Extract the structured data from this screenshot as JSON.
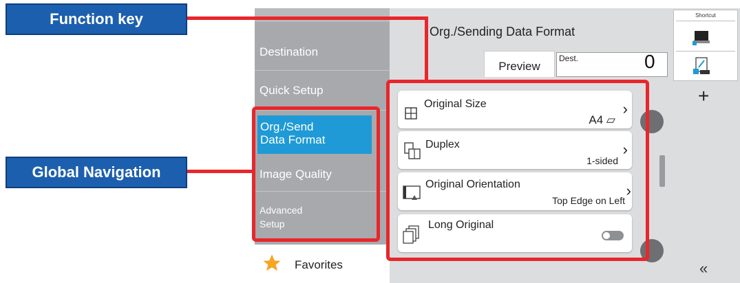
{
  "callouts": {
    "function_key": "Function key",
    "global_navigation": "Global Navigation"
  },
  "nav": {
    "items": [
      {
        "label": "Destination"
      },
      {
        "label": "Quick Setup"
      },
      {
        "label": "Org./Send\nData Format",
        "selected": true
      },
      {
        "label": "Image Quality"
      },
      {
        "label": "Advanced\nSetup"
      }
    ],
    "favorites_label": "Favorites"
  },
  "header": {
    "title": "Org./Sending Data Format",
    "preview_tab": "Preview",
    "dest_label": "Dest.",
    "dest_count": "0"
  },
  "settings": [
    {
      "label": "Original Size",
      "value": "A4 ⏥",
      "icon": "original-size-icon"
    },
    {
      "label": "Duplex",
      "value": "1-sided",
      "icon": "duplex-icon"
    },
    {
      "label": "Original Orientation",
      "value": "Top Edge on Left",
      "icon": "orientation-icon"
    },
    {
      "label": "Long Original",
      "toggle": false,
      "icon": "long-original-icon"
    }
  ],
  "shortcut": {
    "title": "Shortcut",
    "add_symbol": "+",
    "collapse_symbol": "«"
  },
  "colors": {
    "accent": "#1f9ad6",
    "callout_red": "#e8262b",
    "callout_blue": "#1c5fae"
  }
}
